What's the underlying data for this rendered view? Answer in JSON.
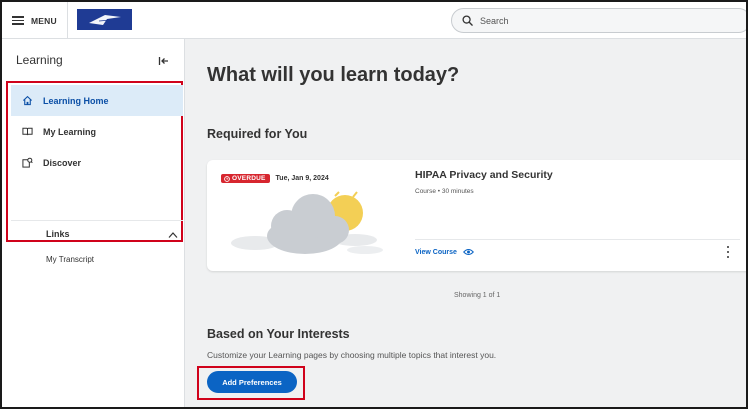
{
  "topbar": {
    "menu_label": "MENU",
    "search_placeholder": "Search"
  },
  "sidebar": {
    "header": "Learning",
    "items": [
      {
        "label": "Learning Home",
        "active": true
      },
      {
        "label": "My Learning",
        "active": false
      },
      {
        "label": "Discover",
        "active": false
      }
    ],
    "links_header": "Links",
    "links": [
      {
        "label": "My Transcript"
      }
    ]
  },
  "main": {
    "heading": "What will you learn today?",
    "required_heading": "Required for You",
    "card": {
      "badge": "OVERDUE",
      "due_date": "Tue, Jan 9, 2024",
      "title": "HIPAA Privacy and Security",
      "meta": "Course  •  30 minutes",
      "view_label": "View Course"
    },
    "showing": "Showing 1 of 1",
    "interests_heading": "Based on Your Interests",
    "interests_desc": "Customize your Learning pages by choosing multiple topics that interest you.",
    "add_preferences_label": "Add Preferences"
  },
  "colors": {
    "accent": "#0b64c4",
    "active_bg": "#dcebf8",
    "overdue": "#d7262f",
    "highlight": "#d0021b",
    "logo_bg": "#1f3b94"
  }
}
